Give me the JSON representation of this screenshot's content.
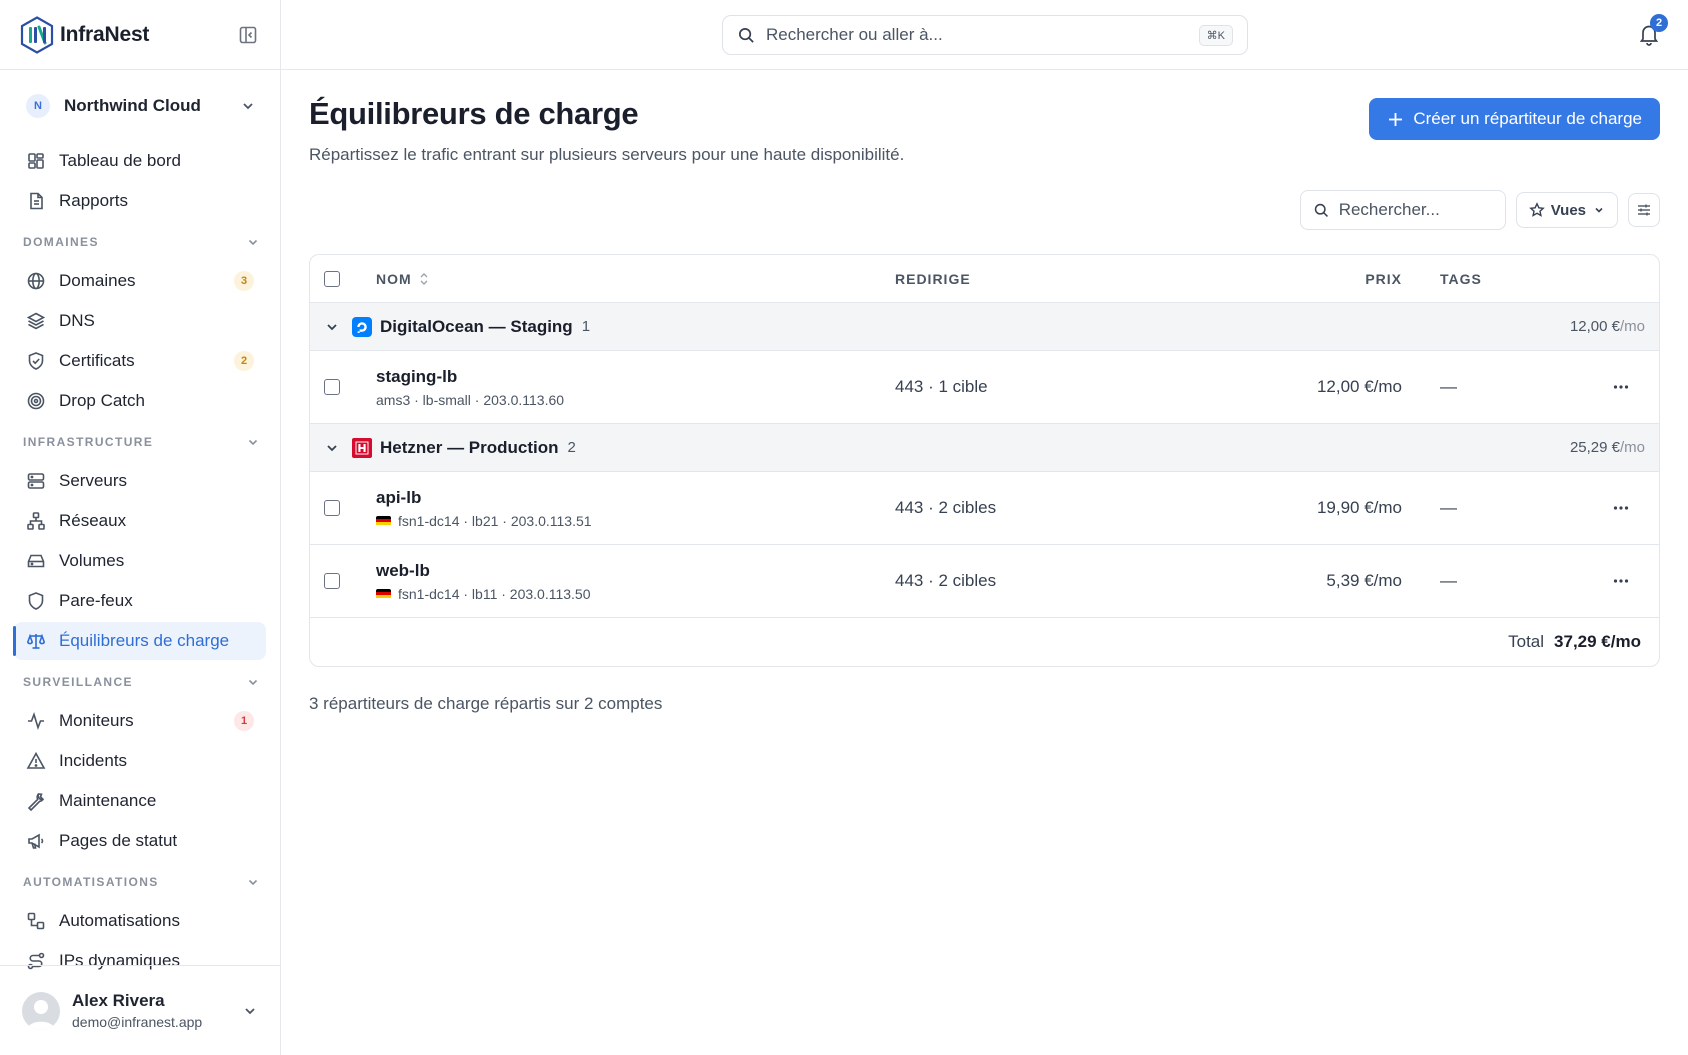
{
  "brand": {
    "name": "InfraNest"
  },
  "org": {
    "initial": "N",
    "name": "Northwind Cloud"
  },
  "nav_top": [
    {
      "label": "Tableau de bord",
      "icon": "dashboard-icon"
    },
    {
      "label": "Rapports",
      "icon": "report-icon"
    }
  ],
  "sections": {
    "domains": {
      "title": "DOMAINES",
      "items": [
        {
          "label": "Domaines",
          "icon": "globe-icon",
          "count": "3"
        },
        {
          "label": "DNS",
          "icon": "layers-icon"
        },
        {
          "label": "Certificats",
          "icon": "shield-check-icon",
          "count": "2"
        },
        {
          "label": "Drop Catch",
          "icon": "target-icon"
        }
      ]
    },
    "infra": {
      "title": "INFRASTRUCTURE",
      "items": [
        {
          "label": "Serveurs",
          "icon": "server-icon"
        },
        {
          "label": "Réseaux",
          "icon": "network-icon"
        },
        {
          "label": "Volumes",
          "icon": "hard-drive-icon"
        },
        {
          "label": "Pare-feux",
          "icon": "shield-icon"
        },
        {
          "label": "Équilibreurs de charge",
          "icon": "scale-icon",
          "active": true
        }
      ]
    },
    "monitoring": {
      "title": "SURVEILLANCE",
      "items": [
        {
          "label": "Moniteurs",
          "icon": "activity-icon",
          "count": "1"
        },
        {
          "label": "Incidents",
          "icon": "alert-triangle-icon"
        },
        {
          "label": "Maintenance",
          "icon": "wrench-icon"
        },
        {
          "label": "Pages de statut",
          "icon": "megaphone-icon"
        }
      ]
    },
    "automation": {
      "title": "AUTOMATISATIONS",
      "items": [
        {
          "label": "Automatisations",
          "icon": "workflow-icon"
        },
        {
          "label": "IPs dynamiques",
          "icon": "route-icon"
        }
      ]
    }
  },
  "user": {
    "name": "Alex Rivera",
    "email": "demo@infranest.app"
  },
  "topbar": {
    "search_placeholder": "Rechercher ou aller à...",
    "shortcut": "⌘K",
    "notifications": "2"
  },
  "page": {
    "title": "Équilibreurs de charge",
    "subtitle": "Répartissez le trafic entrant sur plusieurs serveurs pour une haute disponibilité.",
    "create_label": "Créer un répartiteur de charge",
    "search_placeholder": "Rechercher...",
    "views_label": "Vues"
  },
  "table": {
    "headers": {
      "name": "NOM",
      "redirect": "REDIRIGE",
      "price": "PRIX",
      "tags": "TAGS"
    },
    "groups": [
      {
        "name": "DigitalOcean — Staging",
        "count": "1",
        "total": "12,00 €",
        "total_suffix": "/mo",
        "logo": "digitalocean-logo",
        "rows": [
          {
            "name": "staging-lb",
            "meta": "ams3 · lb-small · 203.0.113.60",
            "flag": "",
            "redirect": "443 · 1 cible",
            "price": "12,00 €/mo",
            "tags": "—"
          }
        ]
      },
      {
        "name": "Hetzner — Production",
        "count": "2",
        "total": "25,29 €",
        "total_suffix": "/mo",
        "logo": "hetzner-logo",
        "rows": [
          {
            "name": "api-lb",
            "meta": "fsn1-dc14 · lb21 · 203.0.113.51",
            "flag": "de-flag",
            "redirect": "443 · 2 cibles",
            "price": "19,90 €/mo",
            "tags": "—"
          },
          {
            "name": "web-lb",
            "meta": "fsn1-dc14 · lb11 · 203.0.113.50",
            "flag": "de-flag",
            "redirect": "443 · 2 cibles",
            "price": "5,39 €/mo",
            "tags": "—"
          }
        ]
      }
    ],
    "footer": {
      "label": "Total",
      "value": "37,29 €/mo"
    }
  },
  "summary": "3 répartiteurs de charge répartis sur 2 comptes",
  "colors": {
    "accent": "#3579e6",
    "active_text": "#2e6ed5",
    "digitalocean": "#0080ff",
    "hetzner": "#d50c2d"
  }
}
